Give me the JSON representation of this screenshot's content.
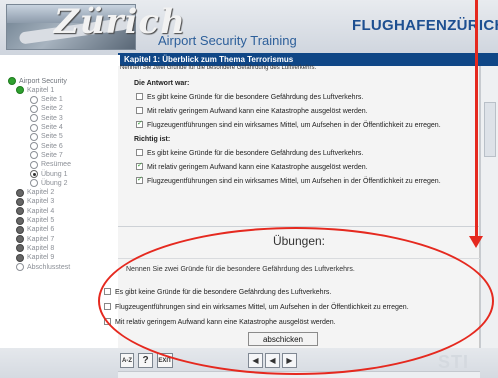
{
  "header": {
    "logo_text": "Zürich",
    "app_title": "Airport Security Training",
    "brand": "FLUGHAFENZÜRICH"
  },
  "chapter_bar": "Kapitel 1: Überblick zum Thema Terrorismus",
  "sidebar": {
    "items": [
      {
        "label": "Airport Security",
        "state": "expanded"
      },
      {
        "label": "Kapitel 1",
        "state": "expanded"
      },
      {
        "label": "Seite 1",
        "state": "unvisited"
      },
      {
        "label": "Seite 2",
        "state": "unvisited"
      },
      {
        "label": "Seite 3",
        "state": "unvisited"
      },
      {
        "label": "Seite 4",
        "state": "unvisited"
      },
      {
        "label": "Seite 5",
        "state": "unvisited"
      },
      {
        "label": "Seite 6",
        "state": "unvisited"
      },
      {
        "label": "Seite 7",
        "state": "unvisited"
      },
      {
        "label": "Resümee",
        "state": "unvisited"
      },
      {
        "label": "Übung 1",
        "state": "current"
      },
      {
        "label": "Übung 2",
        "state": "unvisited"
      },
      {
        "label": "Kapitel 2",
        "state": "collapsed"
      },
      {
        "label": "Kapitel 3",
        "state": "collapsed"
      },
      {
        "label": "Kapitel 4",
        "state": "collapsed"
      },
      {
        "label": "Kapitel 5",
        "state": "collapsed"
      },
      {
        "label": "Kapitel 6",
        "state": "collapsed"
      },
      {
        "label": "Kapitel 7",
        "state": "collapsed"
      },
      {
        "label": "Kapitel 8",
        "state": "collapsed"
      },
      {
        "label": "Kapitel 9",
        "state": "collapsed"
      },
      {
        "label": "Abschlusstest",
        "state": "unvisited"
      }
    ]
  },
  "feedback": {
    "top_text": "Nennen Sie zwei Gründe für die besondere Gefährdung des Luftverkehrs.",
    "your_answer_heading": "Die Antwort war:",
    "your_answer": [
      {
        "text": "Es gibt keine Gründe für die besondere Gefährdung des Luftverkehrs.",
        "checked": false
      },
      {
        "text": "Mit relativ geringem Aufwand kann eine Katastrophe ausgelöst werden.",
        "checked": false
      },
      {
        "text": "Flugzeugentführungen sind ein wirksames Mittel, um Aufsehen in der Öffentlichkeit zu erregen.",
        "checked": true
      }
    ],
    "correct_heading": "Richtig ist:",
    "correct": [
      {
        "text": "Es gibt keine Gründe für die besondere Gefährdung des Luftverkehrs.",
        "checked": false
      },
      {
        "text": "Mit relativ geringem Aufwand kann eine Katastrophe ausgelöst werden.",
        "checked": true
      },
      {
        "text": "Flugzeugentführungen sind ein wirksames Mittel, um Aufsehen in der Öffentlichkeit zu erregen.",
        "checked": true
      }
    ]
  },
  "exercise": {
    "title": "Übungen:",
    "question": "Nennen Sie zwei Gründe für die besondere Gefährdung des Luftverkehrs.",
    "options": [
      "Es gibt keine Gründe für die besondere Gefährdung des Luftverkehrs.",
      "Flugzeugentführungen sind ein wirksames Mittel, um Aufsehen in der Öffentlichkeit zu erregen.",
      "Mit relativ geringem Aufwand kann eine Katastrophe ausgelöst werden."
    ],
    "submit_label": "abschicken"
  },
  "footer": {
    "glossary_label": "A-Z",
    "help_label": "?",
    "exit_label": "EXIT",
    "sti_label": "STI"
  },
  "colors": {
    "accent": "#0f4686",
    "annotation": "#e5291f"
  }
}
